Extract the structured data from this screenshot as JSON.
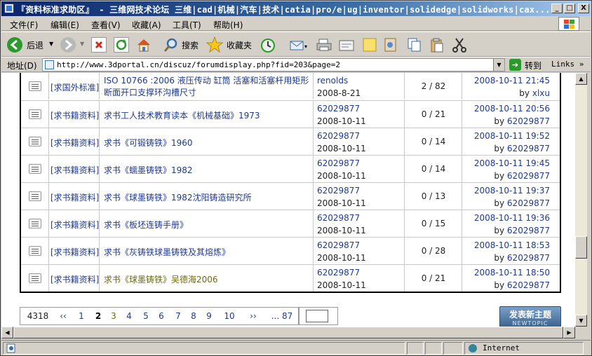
{
  "window": {
    "title": "『资料标准求助区』 - 三维网技术论坛 三维|cad|机械|汽车|技术|catia|pro/e|ug|inventor|solidedge|solidworks|cax...",
    "min_label": "_",
    "max_label": "□",
    "close_label": "X"
  },
  "menu": [
    {
      "label": "文件(F)"
    },
    {
      "label": "编辑(E)"
    },
    {
      "label": "查看(V)"
    },
    {
      "label": "收藏(A)"
    },
    {
      "label": "工具(T)"
    },
    {
      "label": "帮助(H)"
    }
  ],
  "toolbar": {
    "back_label": "后退",
    "search_label": "搜索",
    "favorites_label": "收藏夹"
  },
  "address": {
    "label": "地址(D)",
    "url": "http://www.3dportal.cn/discuz/forumdisplay.php?fid=203&page=2",
    "go_label": "转到",
    "links_label": "Links"
  },
  "threads": [
    {
      "category": "[求国外标准]",
      "title": "ISO 10766 :2006 液压传动 缸筒 活塞和活塞杆用矩形断面开口支撑环沟槽尺寸",
      "author": "renolds",
      "date": "2008-8-21",
      "stats": "2 / 82",
      "last_time": "2008-10-11 21:45",
      "last_by_prefix": "by",
      "last_by": "xlxu",
      "two_line": true
    },
    {
      "category": "[求书籍资料]",
      "title": "求书工人技术教育读本《机械基础》1973",
      "author": "62029877",
      "date": "2008-10-11",
      "stats": "0 / 21",
      "last_time": "2008-10-11 20:56",
      "last_by_prefix": "by",
      "last_by": "62029877"
    },
    {
      "category": "[求书籍资料]",
      "title": "求书《可锻铸铁》1960",
      "author": "62029877",
      "date": "2008-10-11",
      "stats": "0 / 14",
      "last_time": "2008-10-11 19:52",
      "last_by_prefix": "by",
      "last_by": "62029877"
    },
    {
      "category": "[求书籍资料]",
      "title": "求书《蠕墨铸铁》1982",
      "author": "62029877",
      "date": "2008-10-11",
      "stats": "0 / 14",
      "last_time": "2008-10-11 19:45",
      "last_by_prefix": "by",
      "last_by": "62029877"
    },
    {
      "category": "[求书籍资料]",
      "title": "求书《球墨铸铁》1982沈阳铸造研究所",
      "author": "62029877",
      "date": "2008-10-11",
      "stats": "0 / 13",
      "last_time": "2008-10-11 19:37",
      "last_by_prefix": "by",
      "last_by": "62029877"
    },
    {
      "category": "[求书籍资料]",
      "title": "求书《板坯连铸手册》",
      "author": "62029877",
      "date": "2008-10-11",
      "stats": "0 / 15",
      "last_time": "2008-10-11 19:36",
      "last_by_prefix": "by",
      "last_by": "62029877"
    },
    {
      "category": "[求书籍资料]",
      "title": "求书《灰铸铁球墨铸铁及其熔炼》",
      "author": "62029877",
      "date": "2008-10-11",
      "stats": "0 / 28",
      "last_time": "2008-10-11 18:53",
      "last_by_prefix": "by",
      "last_by": "62029877"
    },
    {
      "category": "[求书籍资料]",
      "title": "求书《球墨铸铁》吴德海2006",
      "author": "62029877",
      "date": "2008-10-11",
      "stats": "0 / 21",
      "last_time": "2008-10-11 18:50",
      "last_by_prefix": "by",
      "last_by": "62029877",
      "visited": true
    }
  ],
  "pager": {
    "total": "4318",
    "first": "‹‹",
    "pages": [
      "1",
      "2",
      "3",
      "4",
      "5",
      "6",
      "7",
      "8",
      "9",
      "10"
    ],
    "current": "2",
    "next": "››",
    "last": "... 87",
    "input_value": ""
  },
  "new_topic": {
    "label": "发表新主题",
    "sub": "NEWTOPIC"
  },
  "status": {
    "zone": "Internet"
  },
  "colors": {
    "link": "#1f3a8f",
    "visited": "#6b6b10",
    "titlebar": "#0a246a"
  }
}
